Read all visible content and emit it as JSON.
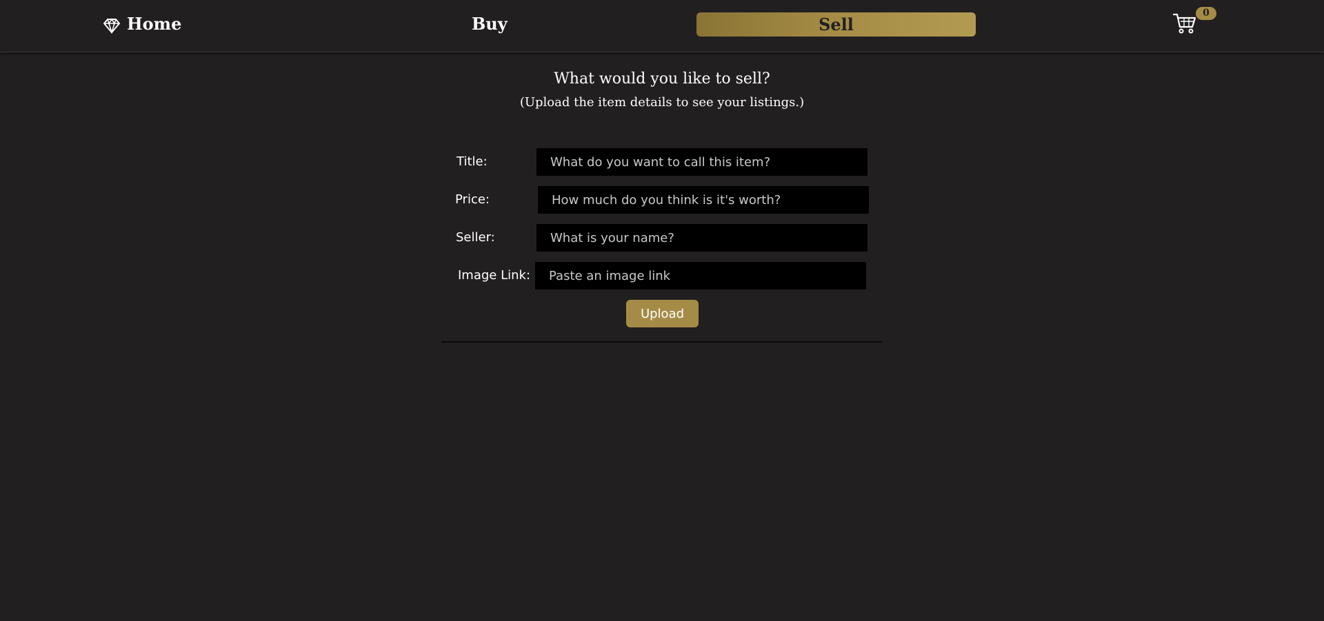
{
  "nav": {
    "home_label": "Home",
    "home_icon": "diamond-icon",
    "buy_label": "Buy",
    "sell_label": "Sell",
    "cart_icon": "shopping-cart-icon",
    "cart_count": "0"
  },
  "page": {
    "heading": "What would you like to sell?",
    "subheading": "(Upload the item details to see your listings.)"
  },
  "form": {
    "title_label": "Title:",
    "title_placeholder": "What do you want to call this item?",
    "title_value": "",
    "price_label": "Price:",
    "price_placeholder": "How much do you think is it's worth?",
    "price_value": "",
    "seller_label": "Seller:",
    "seller_placeholder": "What is your name?",
    "seller_value": "",
    "image_label": "Image Link:",
    "image_placeholder": "Paste an image link",
    "image_value": "",
    "upload_label": "Upload"
  },
  "colors": {
    "background": "#221f20",
    "accent_gold": "#a58c46",
    "input_bg": "#000000",
    "text": "#ffffff"
  }
}
